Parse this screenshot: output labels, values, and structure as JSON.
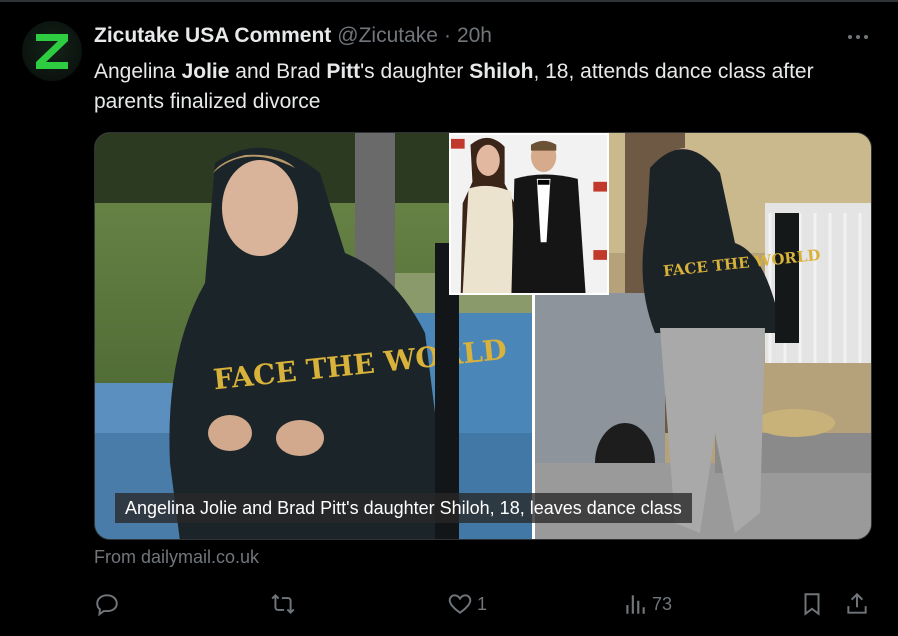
{
  "tweet": {
    "author_name": "Zicutake USA Comment",
    "handle": "@Zicutake",
    "separator": "·",
    "time": "20h",
    "avatar_letter": "Z",
    "text_segments": [
      {
        "text": "Angelina ",
        "bold": false
      },
      {
        "text": "Jolie",
        "bold": true
      },
      {
        "text": " and Brad ",
        "bold": false
      },
      {
        "text": "Pitt",
        "bold": true
      },
      {
        "text": "'s daughter ",
        "bold": false
      },
      {
        "text": "Shiloh",
        "bold": true
      },
      {
        "text": ", 18, attends dance class after parents finalized divorce",
        "bold": false
      }
    ],
    "media": {
      "caption": "Angelina Jolie and Brad Pitt's daughter Shiloh, 18, leaves dance class",
      "hoodie_text": "FACE THE WORLD"
    },
    "source": "From dailymail.co.uk"
  },
  "actions": {
    "reply": {
      "icon": "reply-icon",
      "count": ""
    },
    "retweet": {
      "icon": "retweet-icon",
      "count": ""
    },
    "like": {
      "icon": "heart-icon",
      "count": "1"
    },
    "views": {
      "icon": "views-icon",
      "count": "73"
    },
    "bookmark": {
      "icon": "bookmark-icon"
    },
    "share": {
      "icon": "share-icon"
    }
  },
  "colors": {
    "background": "#000000",
    "text": "#e7e9ea",
    "muted": "#71767b",
    "avatar_green": "#2ecc40"
  }
}
